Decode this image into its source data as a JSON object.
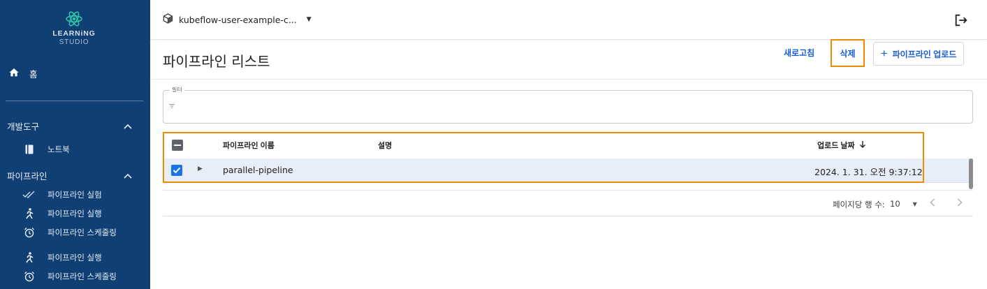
{
  "brand": {
    "line1": "LEARNiNG",
    "line2": "STUDIO",
    "accent": "#2ec4a8"
  },
  "sidebar": {
    "home": {
      "icon": "home-icon",
      "label": "홈"
    },
    "sections": [
      {
        "label": "개발도구",
        "chevron": "chevron-up-icon",
        "items": [
          {
            "icon": "notebook-icon",
            "label": "노트북"
          }
        ]
      },
      {
        "label": "파이프라인",
        "chevron": "chevron-up-icon",
        "items": [
          {
            "icon": "done-all-icon",
            "label": "파이프라인 실험"
          },
          {
            "icon": "run-icon",
            "label": "파이프라인 실행"
          },
          {
            "icon": "alarm-icon",
            "label": "파이프라인 스케줄링"
          },
          {
            "icon": "run-icon",
            "label": "파이프라인 실행"
          },
          {
            "icon": "alarm-icon",
            "label": "파이프라인 스케줄링"
          }
        ]
      }
    ]
  },
  "topbar": {
    "namespace": "kubeflow-user-example-c...",
    "logout_icon": "logout-icon"
  },
  "header": {
    "title": "파이프라인 리스트",
    "refresh_label": "새로고침",
    "delete_label": "삭제",
    "upload_label": "파이프라인 업로드"
  },
  "filter": {
    "label": "필터",
    "icon": "filter-icon"
  },
  "table": {
    "columns": {
      "name": "파이프라인 이름",
      "description": "설명",
      "upload_date": "업로드 날짜"
    },
    "rows": [
      {
        "name": "parallel-pipeline",
        "description": "",
        "upload_date": "2024. 1. 31. 오전 9:37:12",
        "checked": true
      }
    ]
  },
  "pagination": {
    "rows_per_page_label": "페이지당 행 수:",
    "rows_per_page": "10"
  },
  "colors": {
    "sidebar_bg": "#0f3f73",
    "primary": "#1a5fcf",
    "highlight": "#f08a00",
    "row_selected": "#e8eef8"
  }
}
